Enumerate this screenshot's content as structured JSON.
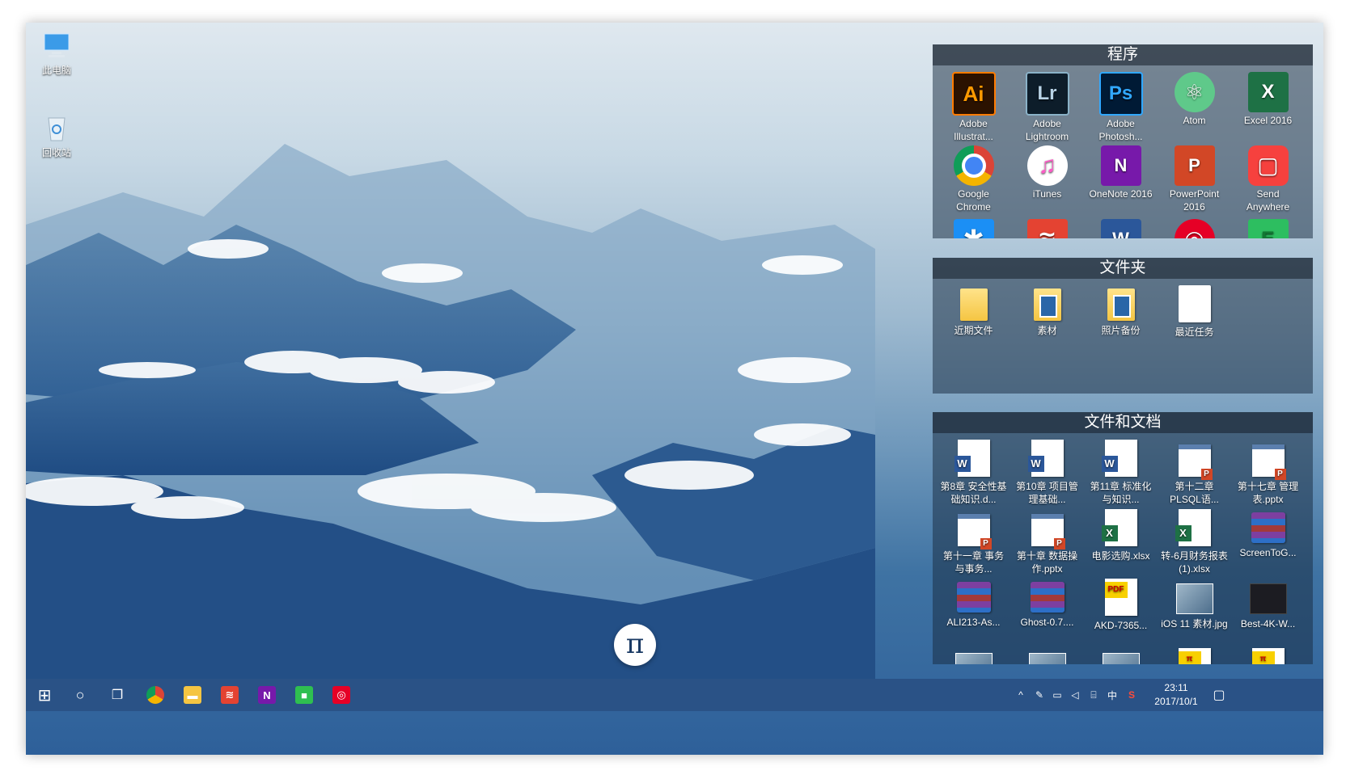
{
  "desktop": {
    "icons": [
      {
        "label": "此电脑",
        "icon": "computer-icon"
      },
      {
        "label": "回收站",
        "icon": "recycle-bin-icon"
      }
    ]
  },
  "fences": {
    "programs": {
      "title": "程序",
      "items": [
        {
          "label": "Adobe Illustrat...",
          "glyph": "Ai",
          "style": "ico-ai"
        },
        {
          "label": "Adobe Lightroom",
          "glyph": "Lr",
          "style": "ico-lr"
        },
        {
          "label": "Adobe Photosh...",
          "glyph": "Ps",
          "style": "ico-ps"
        },
        {
          "label": "Atom",
          "glyph": "⚛",
          "style": "ico-atom"
        },
        {
          "label": "Excel 2016",
          "glyph": "X",
          "style": "ico-excel"
        },
        {
          "label": "Google Chrome",
          "glyph": "",
          "style": "ico-chrome"
        },
        {
          "label": "iTunes",
          "glyph": "♫",
          "style": "ico-itunes"
        },
        {
          "label": "OneNote 2016",
          "glyph": "N",
          "style": "ico-onenote"
        },
        {
          "label": "PowerPoint 2016",
          "glyph": "P",
          "style": "ico-ppt"
        },
        {
          "label": "Send Anywhere",
          "glyph": "▢",
          "style": "ico-send"
        },
        {
          "label": "",
          "glyph": "✱",
          "style": "ico-star"
        },
        {
          "label": "",
          "glyph": "≋",
          "style": "ico-todo"
        },
        {
          "label": "",
          "glyph": "W",
          "style": "ico-word"
        },
        {
          "label": "",
          "glyph": "◎",
          "style": "ico-netease"
        },
        {
          "label": "",
          "glyph": "E",
          "style": "ico-evernote"
        }
      ]
    },
    "folders": {
      "title": "文件夹",
      "items": [
        {
          "label": "近期文件",
          "kind": "folder"
        },
        {
          "label": "素材",
          "kind": "folder photo"
        },
        {
          "label": "照片备份",
          "kind": "folder photo"
        },
        {
          "label": "最近任务",
          "kind": "folder doc"
        }
      ]
    },
    "documents": {
      "title": "文件和文档",
      "items": [
        {
          "label": "第8章 安全性基础知识.d...",
          "kind": "doc w",
          "badge": "W"
        },
        {
          "label": "第10章 项目管理基础...",
          "kind": "doc w",
          "badge": "W"
        },
        {
          "label": "第11章 标准化与知识...",
          "kind": "doc w",
          "badge": "W"
        },
        {
          "label": "第十二章 PLSQL语...",
          "kind": "doc p",
          "badge": "P"
        },
        {
          "label": "第十七章 管理表.pptx",
          "kind": "doc p",
          "badge": "P"
        },
        {
          "label": "第十一章 事务与事务...",
          "kind": "doc p",
          "badge": "P"
        },
        {
          "label": "第十章 数据操作.pptx",
          "kind": "doc p",
          "badge": "P"
        },
        {
          "label": "电影选购.xlsx",
          "kind": "doc x",
          "badge": "X"
        },
        {
          "label": "转-6月财务报表 (1).xlsx",
          "kind": "doc x",
          "badge": "X"
        },
        {
          "label": "ScreenToG...",
          "kind": "rar",
          "badge": ""
        },
        {
          "label": "ALI213-As...",
          "kind": "rar",
          "badge": ""
        },
        {
          "label": "Ghost-0.7....",
          "kind": "rar",
          "badge": ""
        },
        {
          "label": "AKD-7365...",
          "kind": "doc pdf",
          "badge": "PDF"
        },
        {
          "label": "iOS 11 素材.jpg",
          "kind": "imgthumb",
          "badge": ""
        },
        {
          "label": "Best-4K-W...",
          "kind": "imgthumb dark",
          "badge": ""
        },
        {
          "label": "",
          "kind": "imgthumb",
          "badge": ""
        },
        {
          "label": "",
          "kind": "imgthumb",
          "badge": ""
        },
        {
          "label": "",
          "kind": "imgthumb",
          "badge": ""
        },
        {
          "label": "",
          "kind": "doc pdf",
          "badge": "π"
        },
        {
          "label": "",
          "kind": "doc pdf",
          "badge": "π"
        }
      ]
    }
  },
  "pi_button": {
    "glyph": "π"
  },
  "taskbar": {
    "start_glyph": "⊞",
    "search_glyph": "○",
    "taskview_glyph": "❐",
    "apps": [
      {
        "name": "chrome",
        "glyph": "",
        "color": "#db4437"
      },
      {
        "name": "file-explorer",
        "glyph": "▬",
        "color": "#f5c542"
      },
      {
        "name": "todoist",
        "glyph": "≋",
        "color": "#e44332"
      },
      {
        "name": "onenote",
        "glyph": "N",
        "color": "#7719aa"
      },
      {
        "name": "green-app",
        "glyph": "■",
        "color": "#2fbf50"
      },
      {
        "name": "netease-music",
        "glyph": "◎",
        "color": "#e60026"
      }
    ],
    "tray": {
      "chevron": "^",
      "pen": "✎",
      "battery": "▭",
      "volume": "◁",
      "network": "⌸",
      "ime": "中",
      "app": "S"
    },
    "clock": {
      "time": "23:11",
      "date": "2017/10/1"
    },
    "notification_glyph": "▢"
  },
  "colors": {
    "taskbar": "#2a5286",
    "fence_bg": "rgba(25,45,65,0.52)"
  }
}
